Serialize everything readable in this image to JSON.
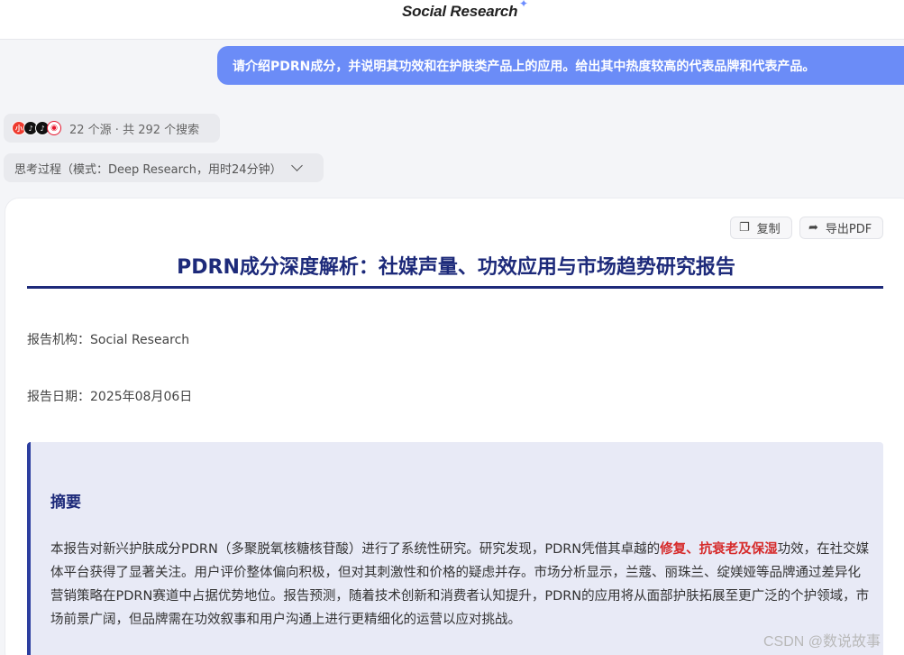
{
  "header": {
    "brand": "Social Research",
    "brand_spark": "✦"
  },
  "user_message": "请介绍PDRN成分，并说明其功效和在护肤类产品上的应用。给出其中热度较高的代表品牌和代表产品。",
  "sources": {
    "icons": [
      "xiaohongshu-icon",
      "douyin-icon",
      "douyin-icon",
      "weibo-icon"
    ],
    "summary": "22 个源 · 共 292 个搜索"
  },
  "thinking": {
    "label": "思考过程（模式：Deep Research，用时24分钟）"
  },
  "toolbar": {
    "copy_label": "复制",
    "export_label": "导出PDF"
  },
  "report": {
    "title": "PDRN成分深度解析：社媒声量、功效应用与市场趋势研究报告",
    "org": "报告机构：Social Research",
    "date": "报告日期：2025年08月06日",
    "abstract": {
      "heading": "摘要",
      "text_before": "本报告对新兴护肤成分PDRN（多聚脱氧核糖核苷酸）进行了系统性研究。研究发现，PDRN凭借其卓越的",
      "highlight": "修复、抗衰老及保湿",
      "text_after": "功效，在社交媒体平台获得了显著关注。用户评价整体偏向积极，但对其刺激性和价格的疑虑并存。市场分析显示，兰蔻、丽珠兰、绽媄娅等品牌通过差异化营销策略在PDRN赛道中占据优势地位。报告预测，随着技术创新和消费者认知提升，PDRN的应用将从面部护肤拓展至更广泛的个护领域，市场前景广阔，但品牌需在功效叙事和用户沟通上进行更精细化的运营以应对挑战。"
    }
  },
  "watermark": "CSDN @数说故事",
  "colors": {
    "accent": "#6b8cf7",
    "title": "#1d2a7a",
    "highlight": "#d62b2b"
  }
}
